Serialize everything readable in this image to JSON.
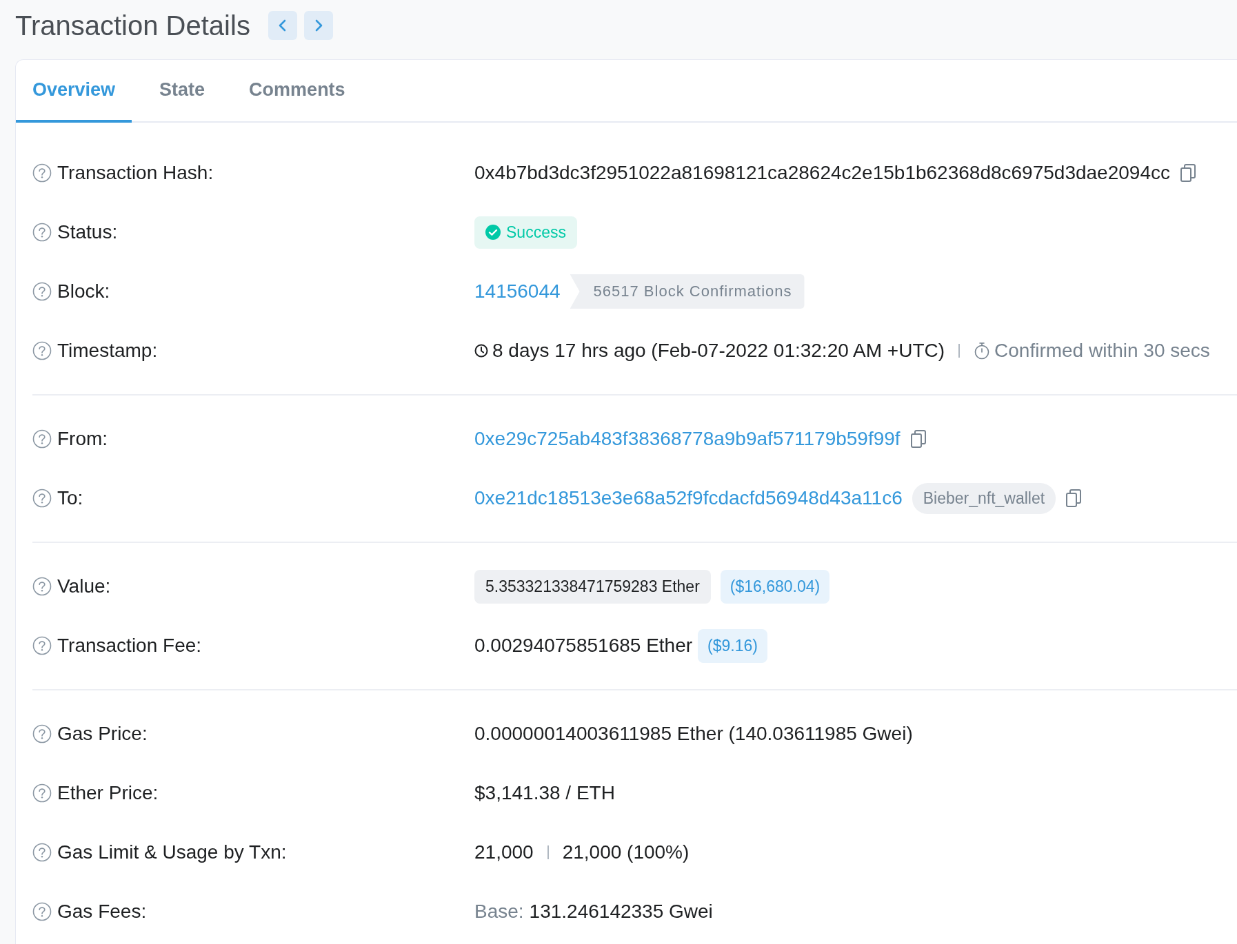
{
  "header": {
    "title": "Transaction Details"
  },
  "tabs": [
    {
      "label": "Overview",
      "selected": true
    },
    {
      "label": "State",
      "selected": false
    },
    {
      "label": "Comments",
      "selected": false
    }
  ],
  "sections": [
    [
      {
        "kind": "hash",
        "label": "Transaction Hash:",
        "value": "0x4b7bd3dc3f2951022a81698121ca28624c2e15b1b62368d8c6975d3dae2094cc"
      },
      {
        "kind": "status",
        "label": "Status:",
        "succeeded": true,
        "text": "Success"
      },
      {
        "kind": "block",
        "label": "Block:",
        "block": "14156044",
        "confirmations": "56517 Block Confirmations"
      },
      {
        "kind": "timestamp",
        "label": "Timestamp:",
        "time": "8 days 17 hrs ago (Feb-07-2022 01:32:20 AM +UTC)",
        "confirmed": "Confirmed within 30 secs"
      }
    ],
    [
      {
        "kind": "address",
        "label": "From:",
        "address": "0xe29c725ab483f38368778a9b9af571179b59f99f"
      },
      {
        "kind": "address",
        "label": "To:",
        "address": "0xe21dc18513e3e68a52f9fcdacfd56948d43a11c6",
        "tag": "Bieber_nft_wallet"
      }
    ],
    [
      {
        "kind": "value",
        "label": "Value:",
        "amount": "5.353321338471759283 Ether",
        "usd": "($16,680.04)"
      },
      {
        "kind": "fee",
        "label": "Transaction Fee:",
        "amount": "0.00294075851685 Ether",
        "usd": "($9.16)"
      }
    ],
    [
      {
        "kind": "text",
        "label": "Gas Price:",
        "value": "0.00000014003611985 Ether (140.03611985 Gwei)"
      },
      {
        "kind": "text",
        "label": "Ether Price:",
        "value": "$3,141.38 / ETH"
      },
      {
        "kind": "usage",
        "label": "Gas Limit & Usage by Txn:",
        "limit": "21,000",
        "used": "21,000 (100%)"
      },
      {
        "kind": "fees",
        "label": "Gas Fees:",
        "prefix": "Base:",
        "value": "131.246142335 Gwei"
      }
    ]
  ]
}
